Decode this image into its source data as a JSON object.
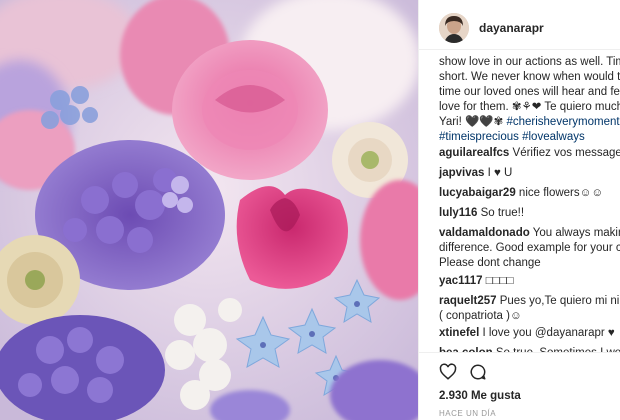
{
  "post": {
    "username": "dayanarapr",
    "caption_lines": [
      "show love in our actions as well. Time",
      "short. We never know when would the",
      "time our loved ones will hear and fee",
      "love for them. ✾⚘❤ Te quiero much",
      "Yari! 🖤🖤✾ #cherisheverymoment",
      "#timeisprecious #lovealways"
    ],
    "caption_tags": [
      "#cherisheverymoment",
      "#timeisprecious",
      "#lovealways"
    ]
  },
  "comments": [
    {
      "user": "aguilarealfcs",
      "text": "Vérifiez vos messages☺"
    },
    {
      "user": "japvivas",
      "text": "I ♥ U"
    },
    {
      "user": "lucyabaigar29",
      "text": "nice flowers☺☺"
    },
    {
      "user": "luly116",
      "text": "So true!!"
    },
    {
      "user": "valdamaldonado",
      "text": "You always making",
      "extra": [
        "difference. Good example for your ch",
        "Please dont change"
      ]
    },
    {
      "user": "yac1117",
      "text": "□□□□"
    },
    {
      "user": "raquelt257",
      "text": "Pues yo,Te quiero mi niña",
      "extra": [
        "( conpatriota )☺"
      ]
    },
    {
      "user": "xtinefel",
      "text": "I love you @dayanarapr ♥"
    },
    {
      "user": "bea.colon",
      "text": "So true. Sometimes I wond"
    }
  ],
  "footer": {
    "likes": "2.930 Me gusta",
    "time": "HACE UN DÍA",
    "icons": [
      "heart-icon",
      "comment-icon"
    ]
  }
}
